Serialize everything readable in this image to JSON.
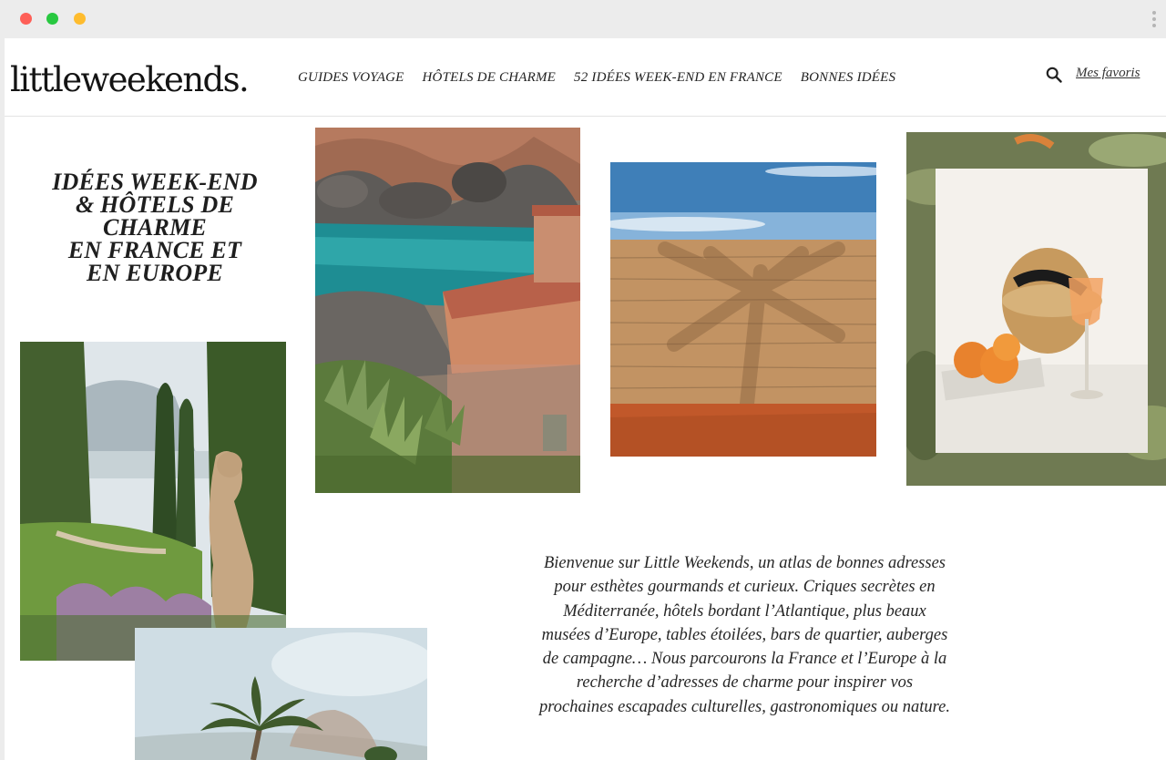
{
  "logo": "littleweekends.",
  "nav": {
    "items": [
      "GUIDES VOYAGE",
      "HÔTELS DE CHARME",
      "52 IDÉES WEEK-END EN FRANCE",
      "BONNES IDÉES"
    ]
  },
  "header_right": {
    "search_icon": "search-icon",
    "favorites_label": "Mes favoris"
  },
  "tagline": {
    "lines": [
      "IDÉES WEEK-END",
      "& HÔTELS DE",
      "CHARME",
      "EN FRANCE ET",
      "EN EUROPE"
    ]
  },
  "intro_text": "Bienvenue sur Little Weekends, un atlas de bonnes adresses pour esthètes gourmands et curieux. Criques secrètes en Méditerranée, hôtels bordant l’Atlantique, plus beaux musées d’Europe, tables étoilées, bars de quartier, auberges de campagne… Nous parcourons la France et l’Europe à la recherche d’adresses de charme pour inspirer vos prochaines escapades culturelles, gastronomiques ou nature.",
  "colors": {
    "window_chrome": "#ececec",
    "close": "#fe5f57",
    "minimize": "#28c840",
    "maximize": "#febc2e",
    "text": "#1e1e1e"
  }
}
